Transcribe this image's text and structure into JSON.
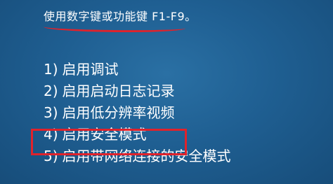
{
  "instruction": "使用数字键或功能键 F1-F9。",
  "options": [
    {
      "number": "1)",
      "label": "启用调试"
    },
    {
      "number": "2)",
      "label": "启用启动日志记录"
    },
    {
      "number": "3)",
      "label": "启用低分辨率视频"
    },
    {
      "number": "4)",
      "label": "启用安全模式"
    },
    {
      "number": "5)",
      "label": "启用带网络连接的安全模式"
    }
  ],
  "colors": {
    "background": "#1f5f92",
    "text": "#ffffff",
    "annotation": "#e0222b"
  }
}
